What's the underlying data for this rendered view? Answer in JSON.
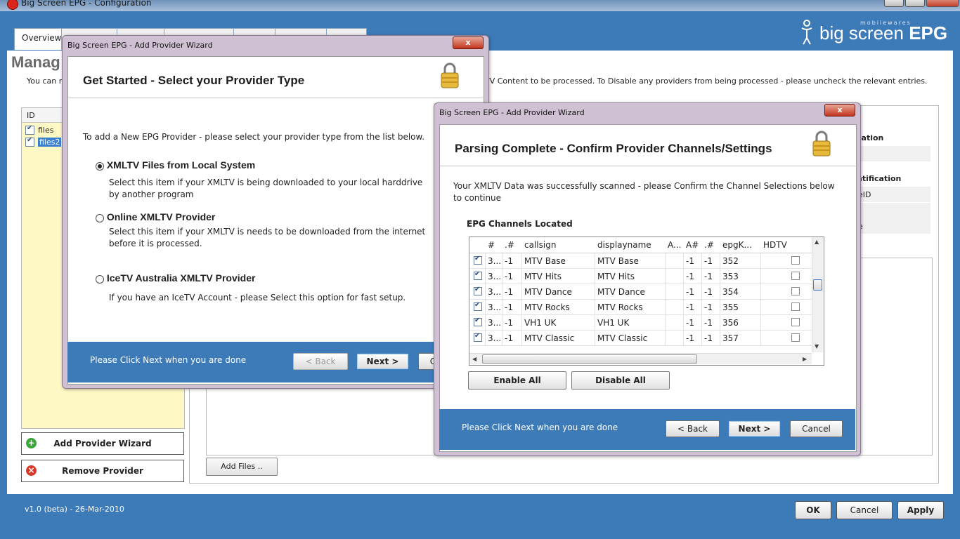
{
  "window": {
    "title": "Big Screen EPG - Configuration"
  },
  "tabs": {
    "overview": "Overview"
  },
  "logo": {
    "brand_small": "mobilewares",
    "brand_light": "big screen",
    "brand_bold": "EPG"
  },
  "page": {
    "heading": "Manag",
    "intro_left": "You can m",
    "intro_right": "TV Content to be processed.  To Disable any providers from being processed - please uncheck the relevant entries."
  },
  "provider_list": {
    "header": "ID",
    "items": [
      {
        "label": "files",
        "checked": true,
        "selected": false
      },
      {
        "label": "files2",
        "checked": true,
        "selected": true
      }
    ]
  },
  "sidebar": {
    "add_provider": "Add Provider Wizard",
    "remove_provider": "Remove Provider"
  },
  "right_panel": {
    "label_location": "cation",
    "label_identification": "ntification",
    "field_id": "eID",
    "field_e": "e",
    "add_files": "Add Files .."
  },
  "footer": {
    "version": "v1.0 (beta) - 26-Mar-2010",
    "ok": "OK",
    "cancel": "Cancel",
    "apply": "Apply"
  },
  "wizard1": {
    "title": "Big Screen EPG - Add Provider Wizard",
    "close": "x",
    "heading": "Get Started - Select your Provider Type",
    "instruction": "To add a New EPG Provider - please select your provider type from the list below.",
    "options": [
      {
        "title": "XMLTV Files from Local System",
        "desc": "Select this item if your XMLTV is being downloaded to your local harddrive by another program",
        "selected": true
      },
      {
        "title": "Online XMLTV Provider",
        "desc": "Select this item if your XMLTV is needs to be downloaded from the internet before it is processed.",
        "selected": false
      },
      {
        "title": "IceTV Australia XMLTV Provider",
        "desc": "If you have an IceTV Account - please Select this option for fast setup.",
        "selected": false
      }
    ],
    "hint": "Please Click Next when you are done",
    "back": "< Back",
    "next": "Next >",
    "cancel_partial": "C"
  },
  "wizard2": {
    "title": "Big Screen EPG - Add Provider Wizard",
    "close": "x",
    "heading": "Parsing Complete - Confirm Provider Channels/Settings",
    "instruction": "Your XMLTV Data was successfully scanned - please Confirm the Channel Selections below to continue",
    "section": "EPG Channels Located",
    "columns": [
      "#",
      ".#",
      "callsign",
      "displayname",
      "A...",
      "A#",
      ".#",
      "epgK...",
      "HDTV"
    ],
    "rows": [
      {
        "checked": true,
        "num": "3...",
        "dot": "-1",
        "callsign": "MTV Base",
        "displayname": "MTV Base",
        "a": "",
        "anum": "-1",
        "dot2": "-1",
        "epgk": "352",
        "hdtv": false
      },
      {
        "checked": true,
        "num": "3...",
        "dot": "-1",
        "callsign": "MTV Hits",
        "displayname": "MTV Hits",
        "a": "",
        "anum": "-1",
        "dot2": "-1",
        "epgk": "353",
        "hdtv": false
      },
      {
        "checked": true,
        "num": "3...",
        "dot": "-1",
        "callsign": "MTV Dance",
        "displayname": "MTV Dance",
        "a": "",
        "anum": "-1",
        "dot2": "-1",
        "epgk": "354",
        "hdtv": false
      },
      {
        "checked": true,
        "num": "3...",
        "dot": "-1",
        "callsign": "MTV Rocks",
        "displayname": "MTV Rocks",
        "a": "",
        "anum": "-1",
        "dot2": "-1",
        "epgk": "355",
        "hdtv": false
      },
      {
        "checked": true,
        "num": "3...",
        "dot": "-1",
        "callsign": "VH1 UK",
        "displayname": "VH1 UK",
        "a": "",
        "anum": "-1",
        "dot2": "-1",
        "epgk": "356",
        "hdtv": false
      },
      {
        "checked": true,
        "num": "3...",
        "dot": "-1",
        "callsign": "MTV Classic",
        "displayname": "MTV Classic",
        "a": "",
        "anum": "-1",
        "dot2": "-1",
        "epgk": "357",
        "hdtv": false
      }
    ],
    "enable_all": "Enable All",
    "disable_all": "Disable All",
    "hint": "Please Click Next when you are done",
    "back": "< Back",
    "next": "Next >",
    "cancel": "Cancel"
  },
  "colors": {
    "accent": "#3d7ab8",
    "dialog_frame": "#cfc0d4",
    "list_bg": "#fdf8c4"
  }
}
